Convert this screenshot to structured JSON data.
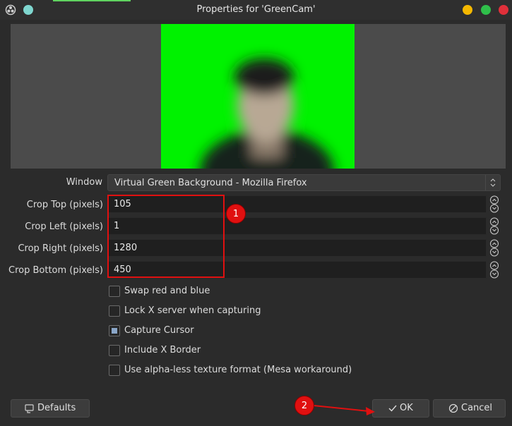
{
  "window": {
    "title": "Properties for 'GreenCam'"
  },
  "fields": {
    "window_label": "Window",
    "window_value": "Virtual Green Background - Mozilla Firefox",
    "crop_top_label": "Crop Top (pixels)",
    "crop_top_value": "105",
    "crop_left_label": "Crop Left (pixels)",
    "crop_left_value": "1",
    "crop_right_label": "Crop Right (pixels)",
    "crop_right_value": "1280",
    "crop_bottom_label": "Crop Bottom (pixels)",
    "crop_bottom_value": "450"
  },
  "checkboxes": [
    {
      "label": "Swap red and blue",
      "checked": false
    },
    {
      "label": "Lock X server when capturing",
      "checked": false
    },
    {
      "label": "Capture Cursor",
      "checked": true
    },
    {
      "label": "Include X Border",
      "checked": false
    },
    {
      "label": "Use alpha-less texture format (Mesa workaround)",
      "checked": false
    }
  ],
  "buttons": {
    "defaults": "Defaults",
    "ok": "OK",
    "cancel": "Cancel"
  },
  "annotations": {
    "badge1": "1",
    "badge2": "2"
  },
  "colors": {
    "accent": "#e01010",
    "preview_bg": "#00f200",
    "minimize": "#f5b800",
    "maximize": "#2fbf4a",
    "close": "#e0303a"
  },
  "icons": [
    "app-icon",
    "cyan-dot-icon",
    "minimize-icon",
    "maximize-icon",
    "close-icon",
    "spin-up-icon",
    "spin-down-icon",
    "defaults-icon",
    "check-icon",
    "cancel-icon"
  ]
}
